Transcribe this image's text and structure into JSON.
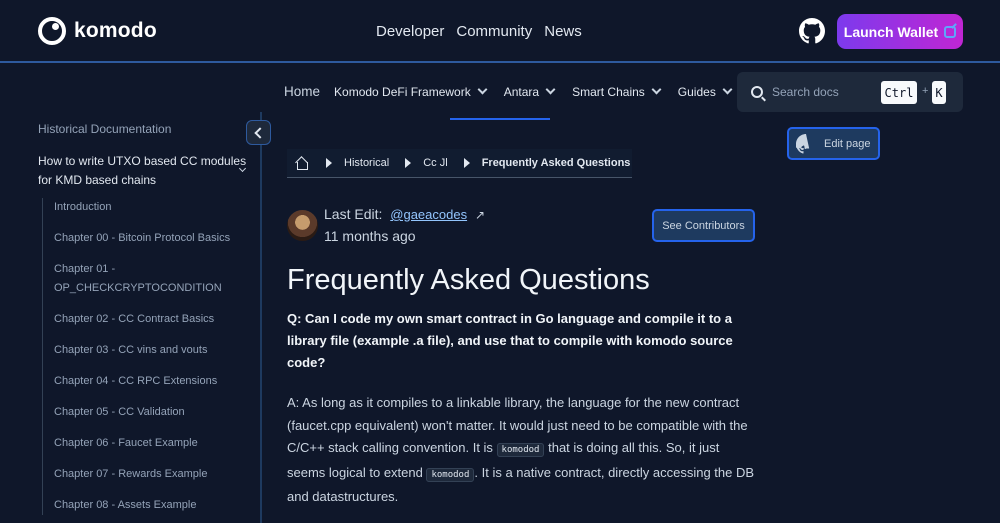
{
  "header": {
    "logo_text": "komodo",
    "nav": [
      "Developer",
      "Community",
      "News"
    ],
    "launch_label": "Launch Wallet"
  },
  "docnav": {
    "home": "Home",
    "menus": [
      "Komodo DeFi Framework",
      "Antara",
      "Smart Chains",
      "Guides"
    ]
  },
  "search": {
    "placeholder": "Search docs",
    "key1": "Ctrl",
    "plus": "+",
    "key2": "K"
  },
  "sidebar": {
    "heading": "Historical Documentation",
    "section": "How to write UTXO based CC modules for KMD based chains",
    "items": [
      "Introduction",
      "Chapter 00 - Bitcoin Protocol Basics",
      "Chapter 01 - OP_CHECKCRYPTOCONDITION",
      "Chapter 02 - CC Contract Basics",
      "Chapter 03 - CC vins and vouts",
      "Chapter 04 - CC RPC Extensions",
      "Chapter 05 - CC Validation",
      "Chapter 06 - Faucet Example",
      "Chapter 07 - Rewards Example",
      "Chapter 08 - Assets Example"
    ]
  },
  "breadcrumb": [
    "Historical",
    "Cc Jl",
    "Frequently Asked Questions"
  ],
  "edit": {
    "label": "Last Edit:",
    "user": "@gaeacodes",
    "ago": "11 months ago",
    "contributors": "See Contributors",
    "edit_page": "Edit page"
  },
  "content": {
    "title": "Frequently Asked Questions",
    "question": "Q: Can I code my own smart contract in Go language and compile it to a library file (example .a file), and use that to compile with komodo source code?",
    "answer_1": "A: As long as it compiles to a linkable library, the language for the new contract (faucet.cpp equivalent) won't matter. It would just need to be compatible with the C/C++ stack calling convention. It is ",
    "code_1": "komodod",
    "answer_2": " that is doing all this. So, it just seems logical to extend ",
    "code_2": "komodod",
    "answer_3": ". It is a native contract, directly accessing the DB and datastructures."
  }
}
